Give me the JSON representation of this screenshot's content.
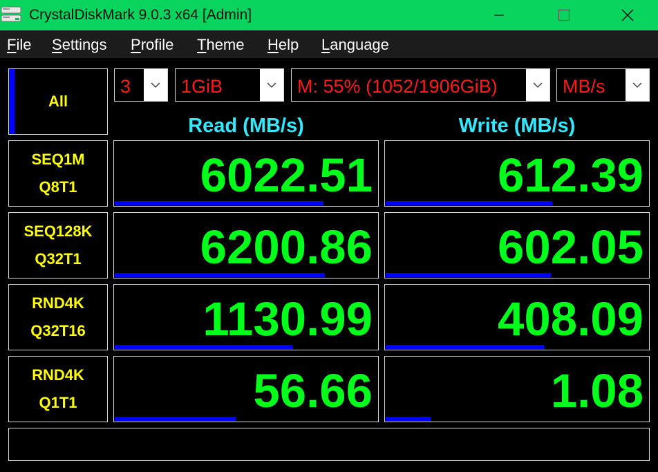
{
  "window": {
    "title": "CrystalDiskMark 9.0.3 x64 [Admin]",
    "titlebar_color": "#08d45e"
  },
  "menu": [
    {
      "accel": "F",
      "rest": "ile"
    },
    {
      "accel": "S",
      "rest": "ettings"
    },
    {
      "accel": "P",
      "rest": "rofile"
    },
    {
      "accel": "T",
      "rest": "heme"
    },
    {
      "accel": "H",
      "rest": "elp"
    },
    {
      "accel": "L",
      "rest": "anguage"
    }
  ],
  "controls": {
    "all_label": "All",
    "count": "3",
    "size": "1GiB",
    "drive": "M: 55% (1052/1906GiB)",
    "unit": "MB/s"
  },
  "headers": {
    "read": "Read (MB/s)",
    "write": "Write (MB/s)"
  },
  "rows": [
    {
      "line1": "SEQ1M",
      "line2": "Q8T1",
      "read": "6022.51",
      "write": "612.39",
      "read_fill": 0.79,
      "write_fill": 0.63
    },
    {
      "line1": "SEQ128K",
      "line2": "Q32T1",
      "read": "6200.86",
      "write": "602.05",
      "read_fill": 0.795,
      "write_fill": 0.625
    },
    {
      "line1": "RND4K",
      "line2": "Q32T16",
      "read": "1130.99",
      "write": "408.09",
      "read_fill": 0.675,
      "write_fill": 0.6
    },
    {
      "line1": "RND4K",
      "line2": "Q1T1",
      "read": "56.66",
      "write": "1.08",
      "read_fill": 0.457,
      "write_fill": 0.171
    }
  ],
  "status_text": "",
  "colors": {
    "label_yellow": "#ffff00",
    "value_green": "#00ff1a",
    "header_cyan": "#33e8ff",
    "combo_red": "#ff1a1a",
    "meter_blue": "#0000ff"
  }
}
